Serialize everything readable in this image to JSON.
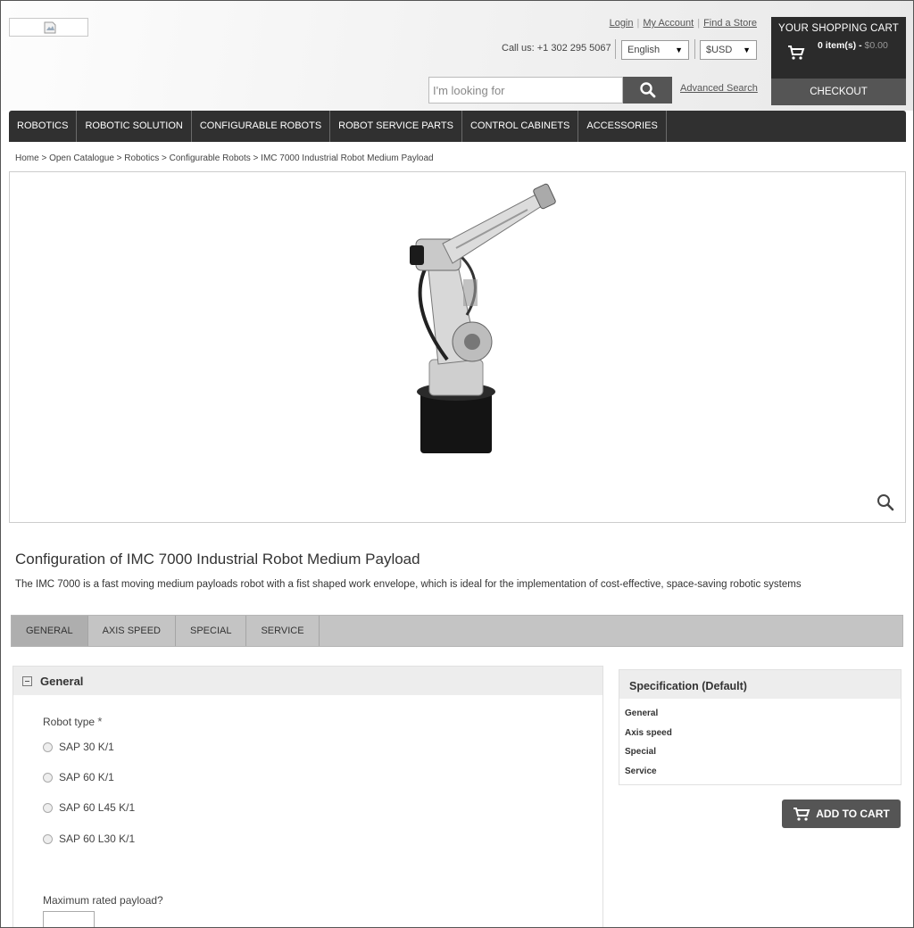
{
  "header": {
    "links": [
      "Login",
      "My Account",
      "Find a Store"
    ],
    "call_us": "Call us: +1 302 295 5067",
    "language": "English",
    "currency": "$USD",
    "search_placeholder": "I'm looking for",
    "advanced_search": "Advanced Search"
  },
  "cart": {
    "title": "YOUR SHOPPING CART",
    "items": "0 item(s) - ",
    "total": "$0.00",
    "checkout": "CHECKOUT"
  },
  "nav": [
    "ROBOTICS",
    "ROBOTIC SOLUTION",
    "CONFIGURABLE ROBOTS",
    "ROBOT SERVICE PARTS",
    "CONTROL CABINETS",
    "ACCESSORIES"
  ],
  "breadcrumb": "Home > Open Catalogue > Robotics > Configurable Robots > IMC 7000 Industrial Robot Medium Payload",
  "product": {
    "title": "Configuration of IMC 7000 Industrial Robot Medium Payload",
    "description": "The IMC 7000 is a fast moving medium payloads robot with a fist shaped work envelope, which is ideal for the implementation of cost-effective, space-saving robotic systems"
  },
  "tabs": [
    "GENERAL",
    "AXIS SPEED",
    "SPECIAL",
    "SERVICE"
  ],
  "general_panel": {
    "title": "General",
    "robot_type_label": "Robot type",
    "required_mark": "*",
    "options": [
      "SAP 30 K/1",
      "SAP 60 K/1",
      "SAP 60 L45 K/1",
      "SAP 60 L30 K/1"
    ],
    "payload_label": "Maximum rated payload?"
  },
  "spec": {
    "title": "Specification (Default)",
    "items": [
      "General",
      "Axis speed",
      "Special",
      "Service"
    ]
  },
  "add_to_cart": "ADD TO CART"
}
